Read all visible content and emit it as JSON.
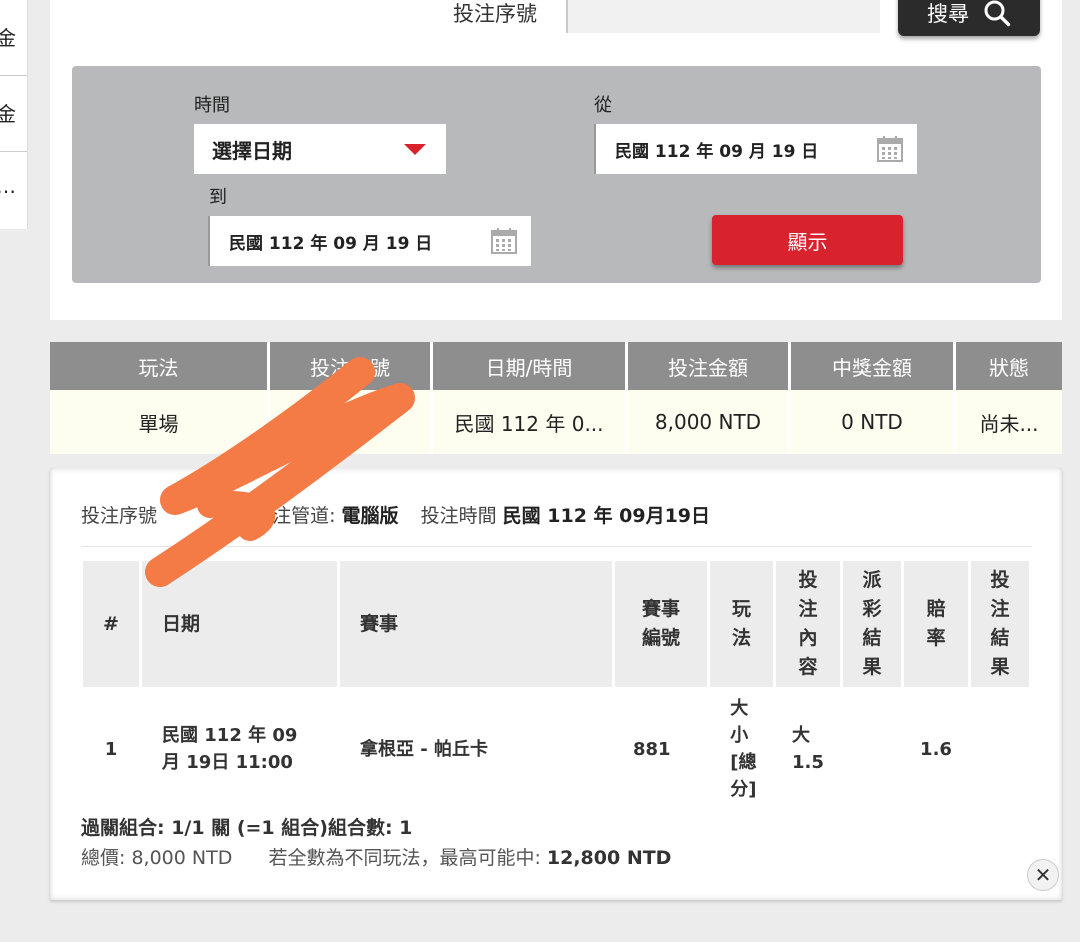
{
  "sidebar": {
    "items": [
      "金",
      "金",
      "…"
    ]
  },
  "search": {
    "serial_label": "投注序號",
    "serial_value": "",
    "button_label": "搜尋"
  },
  "filter": {
    "time_label": "時間",
    "select_value": "選擇日期",
    "from_label": "從",
    "from_date": "民國 112 年 09 月 19 日",
    "to_label": "到",
    "to_date": "民國 112 年 09 月 19 日",
    "show_button": "顯示"
  },
  "results": {
    "headers": [
      "玩法",
      "投注序號",
      "日期/時間",
      "投注金額",
      "中獎金額",
      "狀態"
    ],
    "row": [
      "單場",
      "",
      "民國 112 年 0...",
      "8,000 NTD",
      "0 NTD",
      "尚未..."
    ]
  },
  "detail": {
    "serial_label": "投注序號",
    "channel_label": "投注管道:",
    "channel_value": "電腦版",
    "time_label": "投注時間",
    "time_value": "民國 112 年 09月19日",
    "headers": {
      "num": "#",
      "date": "日期",
      "event": "賽事",
      "event_no": "賽事編號",
      "play": "玩法",
      "content": "投注內容",
      "payout": "派彩結果",
      "odds": "賠率",
      "result": "投注結果"
    },
    "row": {
      "num": "1",
      "date": "民國 112 年 09月 19日 11:00",
      "event": "拿根亞 - 帕丘卡",
      "event_no": "881",
      "play": "大小[總分]",
      "content": "大 1.5",
      "payout": "",
      "odds": "1.6",
      "result": ""
    },
    "combo_text": "過關組合: 1/1 關 (=1 組合)組合數: 1",
    "total_label": "總價:",
    "total_value": "8,000 NTD",
    "max_label": "若全數為不同玩法，最高可能中:",
    "max_value": "12,800 NTD"
  },
  "colors": {
    "accent_red": "#d8222d",
    "header_gray": "#8e8e8e",
    "filter_bg": "#b8b9ba",
    "scribble": "#f47a46"
  }
}
